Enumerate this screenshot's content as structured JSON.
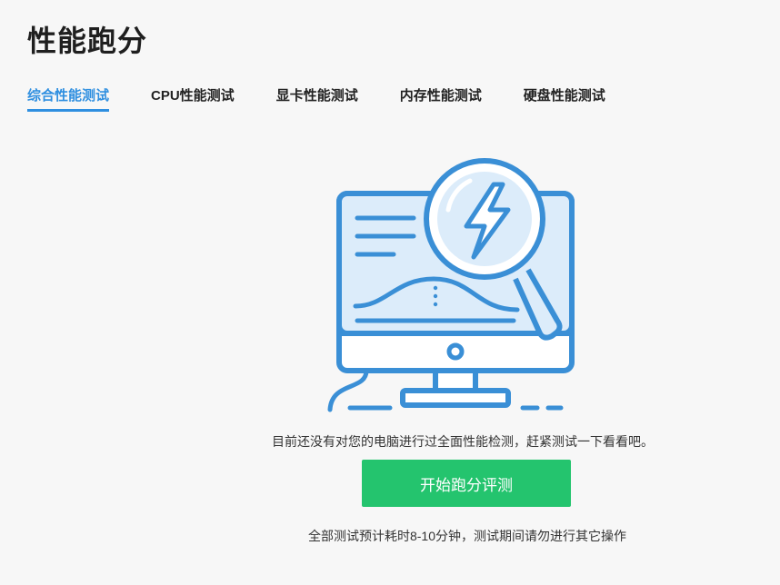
{
  "page": {
    "title": "性能跑分"
  },
  "tabs": [
    {
      "label": "综合性能测试",
      "active": true
    },
    {
      "label": "CPU性能测试",
      "active": false
    },
    {
      "label": "显卡性能测试",
      "active": false
    },
    {
      "label": "内存性能测试",
      "active": false
    },
    {
      "label": "硬盘性能测试",
      "active": false
    }
  ],
  "empty_state": {
    "illustration_icon": "monitor-with-magnifier-lightning-icon",
    "message": "目前还没有对您的电脑进行过全面性能检测，赶紧测试一下看看吧。",
    "start_button_label": "开始跑分评测",
    "note": "全部测试预计耗时8-10分钟，测试期间请勿进行其它操作"
  },
  "colors": {
    "accent_blue": "#2f8fe0",
    "illustration_blue": "#3a8fd6",
    "illustration_fill": "#dcecfa",
    "button_green": "#24c46e",
    "background": "#f7f7f7"
  }
}
